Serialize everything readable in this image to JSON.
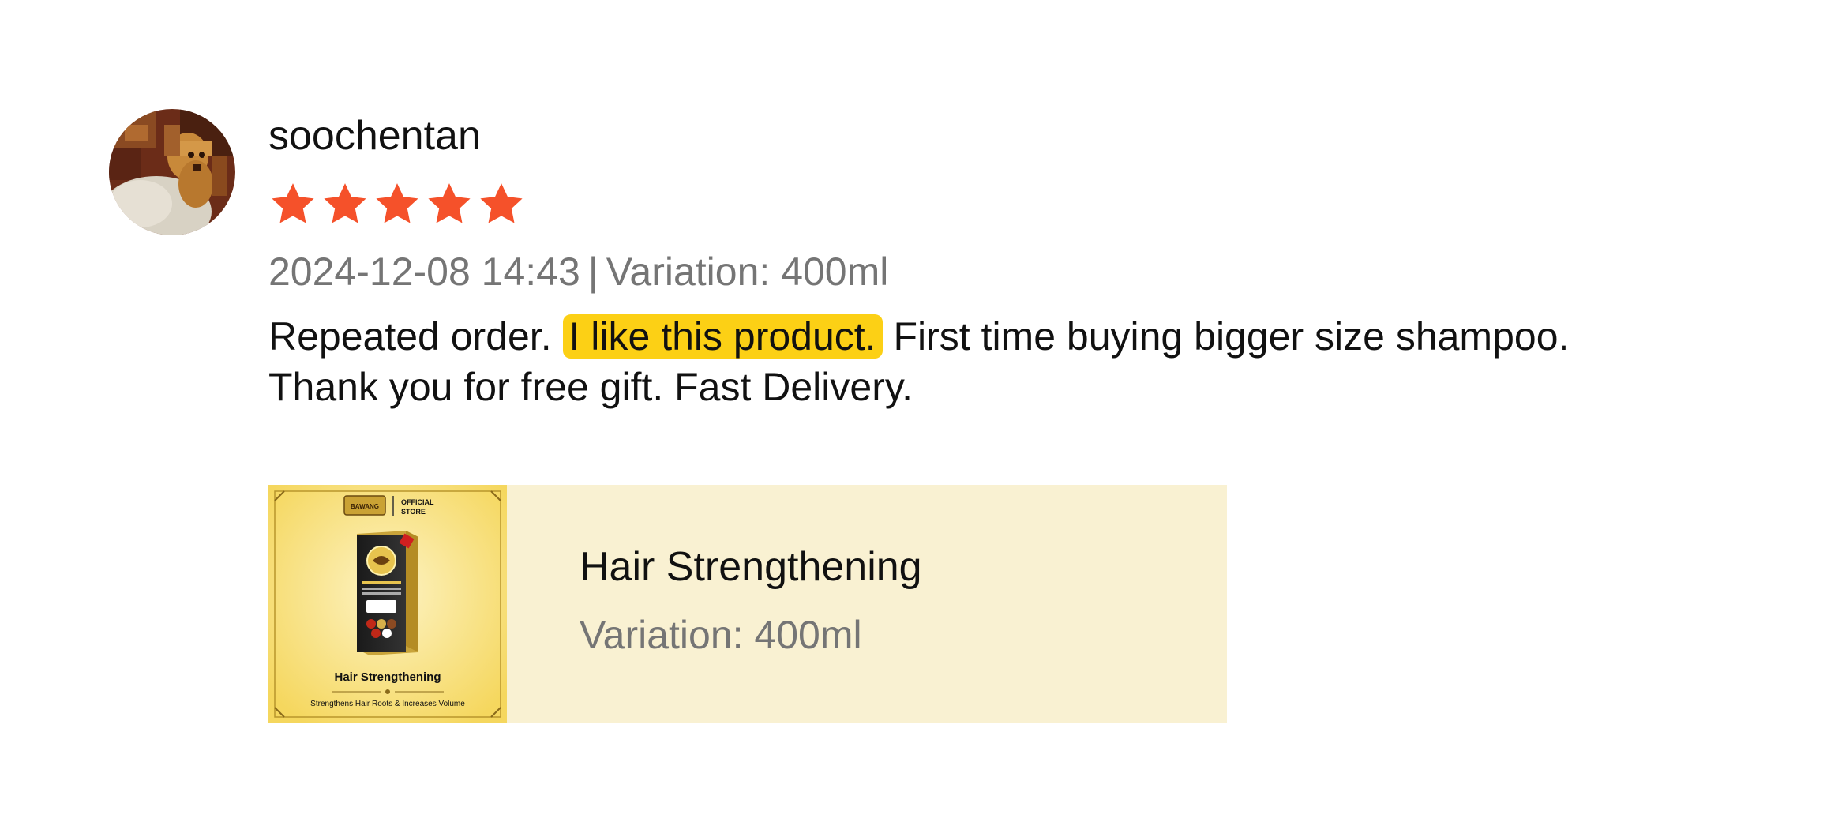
{
  "review": {
    "username": "soochentan",
    "rating": 5,
    "rating_max": 5,
    "date": "2024-12-08 14:43",
    "separator": "|",
    "variation": "Variation: 400ml",
    "text": {
      "part1": "Repeated order.",
      "highlight": "I like this product.",
      "part2": "First time buying bigger size shampoo.",
      "line2": "Thank you for free gift. Fast Delivery."
    }
  },
  "product": {
    "name": "Hair Strengthening",
    "variation": "Variation: 400ml",
    "thumbnail": {
      "brand": "BAWANG",
      "badge": "OFFICIAL STORE",
      "title": "Hair Strengthening",
      "subtitle": "Strengthens Hair Roots & Increases Volume"
    }
  },
  "icons": {
    "star": "star-icon",
    "avatar": "user-avatar"
  },
  "colors": {
    "star": "#f5512a",
    "highlight": "#fcd015",
    "card_bg": "#f9f1d2",
    "meta_text": "#757575",
    "thumb_bg": "#f7dc6f"
  }
}
